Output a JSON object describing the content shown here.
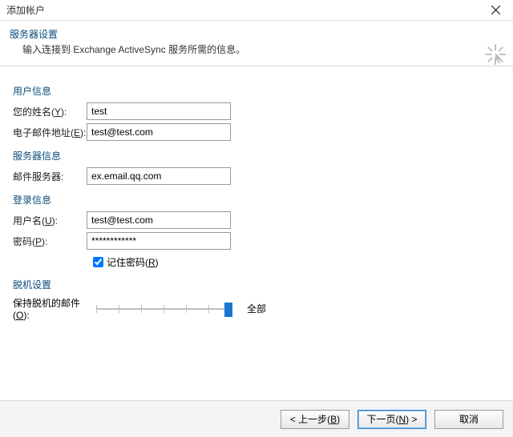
{
  "window": {
    "title": "添加帐户"
  },
  "header": {
    "title": "服务器设置",
    "subtitle": "输入连接到 Exchange ActiveSync 服务所需的信息。"
  },
  "sections": {
    "user_info": "用户信息",
    "server_info": "服务器信息",
    "login_info": "登录信息",
    "offline": "脱机设置"
  },
  "labels": {
    "your_name": "您的姓名(",
    "your_name_u": "Y",
    "your_name_end": "):",
    "email": "电子邮件地址(",
    "email_u": "E",
    "email_end": "):",
    "mail_server": "邮件服务器:",
    "username": "用户名(",
    "username_u": "U",
    "username_end": "):",
    "password": "密码(",
    "password_u": "P",
    "password_end": "):",
    "remember_pw": "记住密码(",
    "remember_pw_u": "R",
    "remember_pw_end": ")",
    "offline_mail": "保持脱机的邮件(",
    "offline_mail_u": "O",
    "offline_mail_end": "):",
    "slider_all": "全部"
  },
  "values": {
    "name": "test",
    "email": "test@test.com",
    "server": "ex.email.qq.com",
    "username": "test@test.com",
    "password": "************",
    "remember_pw_checked": true
  },
  "buttons": {
    "back": "< 上一步(",
    "back_u": "B",
    "back_end": ")",
    "next": "下一页(",
    "next_u": "N",
    "next_end": ") >",
    "cancel": "取消"
  }
}
